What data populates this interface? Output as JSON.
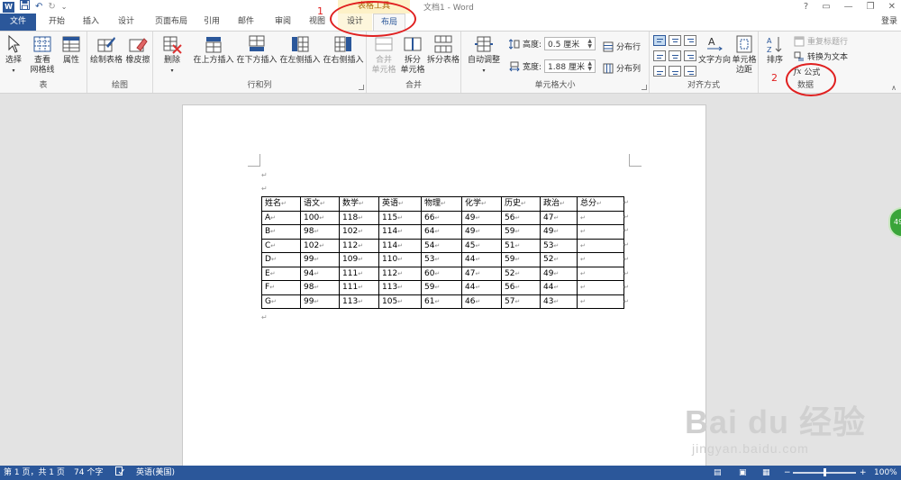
{
  "qat": {
    "logo": "W",
    "save_icon": "save-icon",
    "undo": "↶",
    "redo": "↻",
    "customize": "⌄"
  },
  "title": {
    "doc": "文档1 - Word",
    "context_group": "表格工具"
  },
  "window": {
    "help": "?",
    "restore_ribbon": "▭",
    "minimize": "—",
    "maximize": "❐",
    "close": "✕"
  },
  "tabs": [
    "文件",
    "开始",
    "插入",
    "设计",
    "页面布局",
    "引用",
    "邮件",
    "审阅",
    "视图",
    "设计",
    "布局"
  ],
  "signin": "登录",
  "ribbon": {
    "table": {
      "select": "选择",
      "gridlines": [
        "查看",
        "网格线"
      ],
      "properties": "属性",
      "label": "表"
    },
    "draw": {
      "draw_table": "绘制表格",
      "eraser": "橡皮擦",
      "label": "绘图"
    },
    "rowscols": {
      "delete": "删除",
      "insert_above": "在上方插入",
      "insert_below": "在下方插入",
      "insert_left": "在左侧插入",
      "insert_right": "在右侧插入",
      "label": "行和列"
    },
    "merge": {
      "merge_cells": [
        "合并",
        "单元格"
      ],
      "split_cells": [
        "拆分",
        "单元格"
      ],
      "split_table": "拆分表格",
      "label": "合并"
    },
    "cellsize": {
      "autofit": "自动调整",
      "height_label": "高度:",
      "height_value": "0.5 厘米",
      "width_label": "宽度:",
      "width_value": "1.88 厘米",
      "dist_rows": "分布行",
      "dist_cols": "分布列",
      "label": "单元格大小"
    },
    "alignment": {
      "text_dir": "文字方向",
      "cell_margins": [
        "单元格",
        "边距"
      ],
      "label": "对齐方式"
    },
    "data": {
      "sort": "排序",
      "repeat_header": "重复标题行",
      "convert_text": "转换为文本",
      "formula": "公式",
      "label": "数据"
    }
  },
  "annotations": {
    "one": "1",
    "two": "2"
  },
  "para_mark": "↵",
  "table": {
    "headers": [
      "姓名",
      "语文",
      "数学",
      "英语",
      "物理",
      "化学",
      "历史",
      "政治",
      "总分"
    ],
    "rows": [
      [
        "A",
        "100",
        "118",
        "115",
        "66",
        "49",
        "56",
        "47",
        ""
      ],
      [
        "B",
        "98",
        "102",
        "114",
        "64",
        "49",
        "59",
        "49",
        ""
      ],
      [
        "C",
        "102",
        "112",
        "114",
        "54",
        "45",
        "51",
        "53",
        ""
      ],
      [
        "D",
        "99",
        "109",
        "110",
        "53",
        "44",
        "59",
        "52",
        ""
      ],
      [
        "E",
        "94",
        "111",
        "112",
        "60",
        "47",
        "52",
        "49",
        ""
      ],
      [
        "F",
        "98",
        "111",
        "113",
        "59",
        "44",
        "56",
        "44",
        ""
      ],
      [
        "G",
        "99",
        "113",
        "105",
        "61",
        "46",
        "57",
        "43",
        ""
      ]
    ]
  },
  "side_bubble": "49",
  "watermark": {
    "main": "Bai du 经验",
    "sub": "jingyan.baidu.com"
  },
  "status": {
    "page": "第 1 页，共 1 页",
    "words": "74 个字",
    "lang": "英语(美国)",
    "zoom_minus": "−",
    "zoom_plus": "+",
    "zoom": "100%",
    "zoom_level": 0.5
  },
  "colors": {
    "accent": "#2b579a",
    "annotation": "#e02020",
    "context_tab": "#fdf1c7"
  }
}
